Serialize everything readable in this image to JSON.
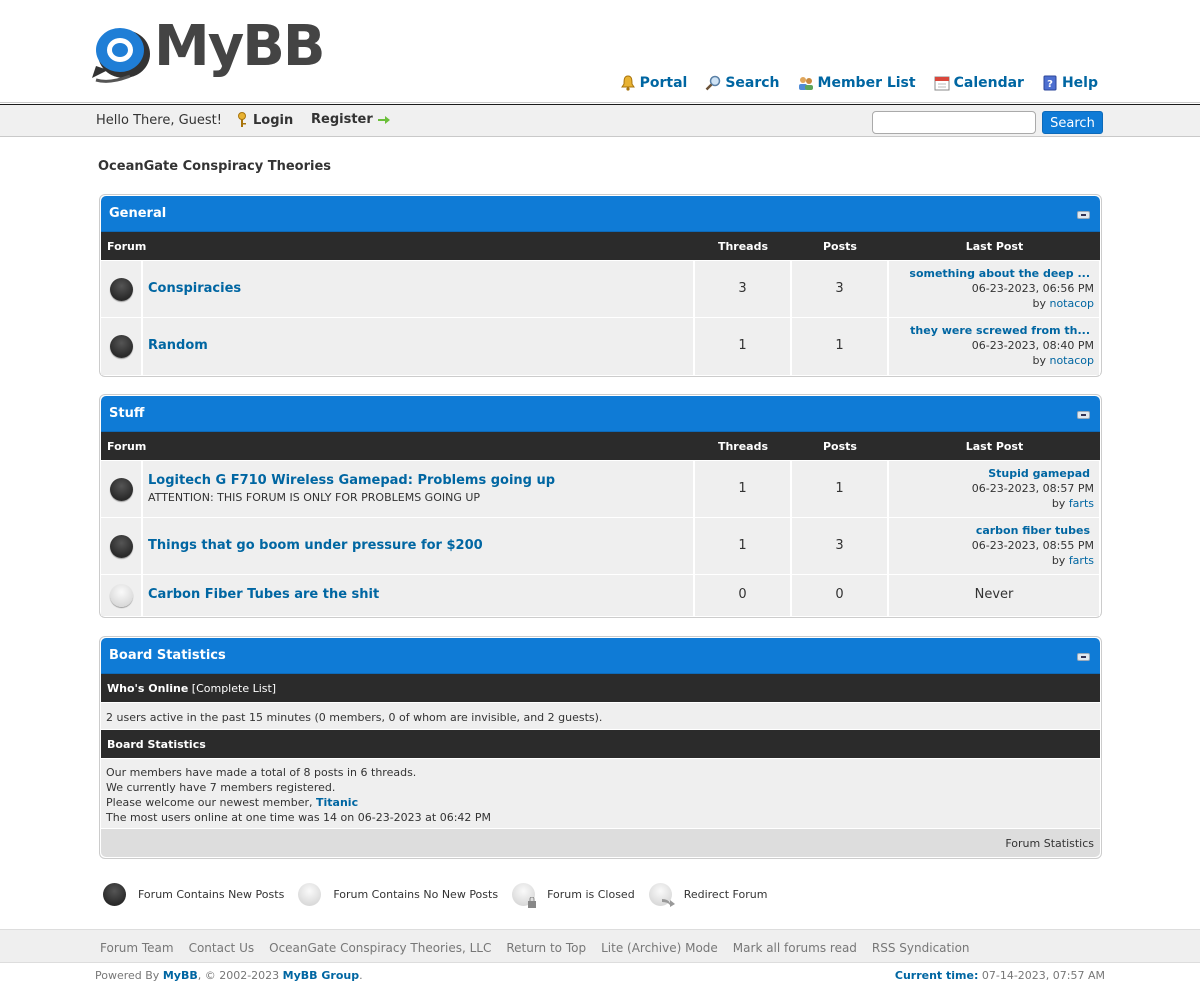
{
  "header": {
    "logo_text": "MyBB",
    "links": [
      {
        "label": "Portal",
        "icon": "portal-icon"
      },
      {
        "label": "Search",
        "icon": "search-icon"
      },
      {
        "label": "Member List",
        "icon": "members-icon"
      },
      {
        "label": "Calendar",
        "icon": "calendar-icon"
      },
      {
        "label": "Help",
        "icon": "help-icon"
      }
    ]
  },
  "panel": {
    "greeting": "Hello There, Guest!",
    "login": "Login",
    "register": "Register",
    "search_button": "Search",
    "search_placeholder": ""
  },
  "breadcrumb": "OceanGate Conspiracy Theories",
  "columns": {
    "forum": "Forum",
    "threads": "Threads",
    "posts": "Posts",
    "last_post": "Last Post"
  },
  "categories": [
    {
      "title": "General",
      "forums": [
        {
          "name": "Conspiracies",
          "desc": "",
          "threads": "3",
          "posts": "3",
          "status": "new",
          "last_title": "something about the deep ...",
          "last_date": "06-23-2023, 06:56 PM",
          "last_by": "by",
          "last_user": "notacop"
        },
        {
          "name": "Random",
          "desc": "",
          "threads": "1",
          "posts": "1",
          "status": "new",
          "last_title": "they were screwed from th...",
          "last_date": "06-23-2023, 08:40 PM",
          "last_by": "by",
          "last_user": "notacop"
        }
      ]
    },
    {
      "title": "Stuff",
      "forums": [
        {
          "name": "Logitech G F710 Wireless Gamepad: Problems going up",
          "desc": "ATTENTION: THIS FORUM IS ONLY FOR PROBLEMS GOING UP",
          "threads": "1",
          "posts": "1",
          "status": "new",
          "last_title": "Stupid gamepad",
          "last_date": "06-23-2023, 08:57 PM",
          "last_by": "by",
          "last_user": "farts"
        },
        {
          "name": "Things that go boom under pressure for $200",
          "desc": "",
          "threads": "1",
          "posts": "3",
          "status": "new",
          "last_title": "carbon fiber tubes",
          "last_date": "06-23-2023, 08:55 PM",
          "last_by": "by",
          "last_user": "farts"
        },
        {
          "name": "Carbon Fiber Tubes are the shit",
          "desc": "",
          "threads": "0",
          "posts": "0",
          "status": "none",
          "never": "Never"
        }
      ]
    }
  ],
  "board_stats": {
    "title": "Board Statistics",
    "whos_online": "Who's Online",
    "complete_list": "[Complete List]",
    "online_text": "2 users active in the past 15 minutes (0 members, 0 of whom are invisible, and 2 guests).",
    "stats_heading": "Board Statistics",
    "line1": "Our members have made a total of 8 posts in 6 threads.",
    "line2": "We currently have 7 members registered.",
    "line3_prefix": "Please welcome our newest member,",
    "newest_member": "Titanic",
    "line4": "The most users online at one time was 14 on 06-23-2023 at 06:42 PM",
    "forum_statistics": "Forum Statistics"
  },
  "legend": [
    {
      "label": "Forum Contains New Posts"
    },
    {
      "label": "Forum Contains No New Posts"
    },
    {
      "label": "Forum is Closed"
    },
    {
      "label": "Redirect Forum"
    }
  ],
  "footer": {
    "links": [
      "Forum Team",
      "Contact Us",
      "OceanGate Conspiracy Theories, LLC",
      "Return to Top",
      "Lite (Archive) Mode",
      "Mark all forums read",
      "RSS Syndication"
    ],
    "powered_by": "Powered By",
    "mybb": "MyBB",
    "copyright": ", © 2002-2023",
    "mybb_group": "MyBB Group",
    "period": ".",
    "current_time_label": "Current time:",
    "current_time": "07-14-2023, 07:57 AM"
  },
  "colors": {
    "accent": "#0f7bd6",
    "link": "#0066a2",
    "category": "#2b2b2b"
  }
}
